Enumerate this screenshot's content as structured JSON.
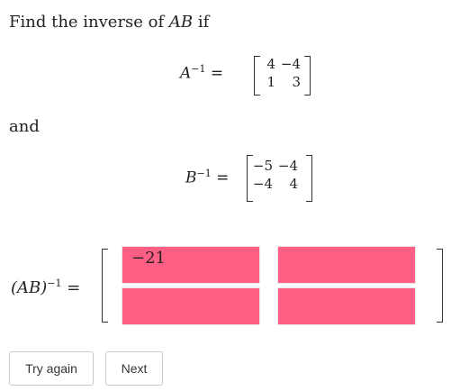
{
  "question": {
    "prefix": "Find the inverse of ",
    "product": "AB",
    "suffix": " if",
    "and_word": "and"
  },
  "a_inverse": {
    "label": "A",
    "exp": "−1",
    "eq": "=",
    "matrix": [
      [
        "4",
        "−4"
      ],
      [
        "1",
        "3"
      ]
    ]
  },
  "b_inverse": {
    "label": "B",
    "exp": "−1",
    "eq": "=",
    "matrix": [
      [
        "−5",
        "−4"
      ],
      [
        "−4",
        "4"
      ]
    ]
  },
  "answer": {
    "label": "(AB)",
    "exp": "−1",
    "eq": "=",
    "cells": [
      {
        "value": "−21",
        "status": "incorrect"
      },
      {
        "value": "",
        "status": "incorrect"
      },
      {
        "value": "",
        "status": "incorrect"
      },
      {
        "value": "",
        "status": "incorrect"
      }
    ],
    "incorrect_color": "#ff5f85"
  },
  "buttons": {
    "try_again": "Try again",
    "next": "Next"
  }
}
